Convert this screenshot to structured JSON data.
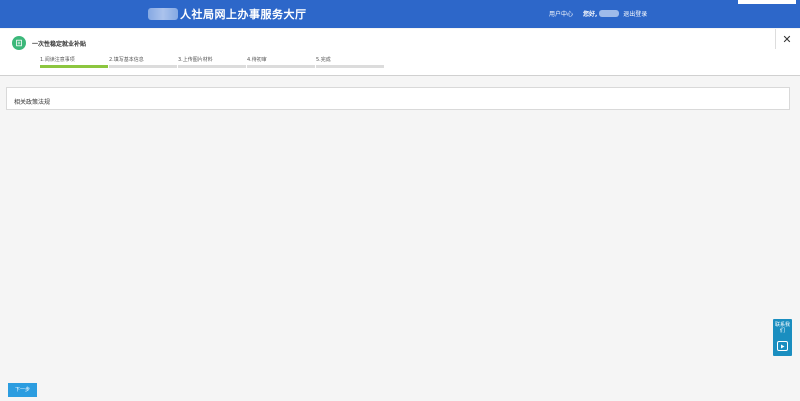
{
  "header": {
    "title": "人社局网上办事服务大厅",
    "user_center": "用户中心",
    "greeting": "您好,",
    "logout": "退出登录"
  },
  "service": {
    "title": "一次性稳定就业补贴",
    "icon": "document-icon"
  },
  "steps": [
    {
      "label": "1.阅读注意事项",
      "active": true
    },
    {
      "label": "2.填写基本信息",
      "active": false
    },
    {
      "label": "3.上传图片材料",
      "active": false
    },
    {
      "label": "4.待初审",
      "active": false
    },
    {
      "label": "5.完成",
      "active": false
    }
  ],
  "policy": {
    "title": "相关政策法规"
  },
  "side_widget": {
    "label": "联系我们",
    "icon": "play-icon"
  },
  "footer": {
    "next_label": "下一步"
  },
  "colors": {
    "header_bg": "#2d67c9",
    "step_active": "#8cc63f",
    "button": "#2c9de0",
    "service_icon": "#3cb87a"
  }
}
